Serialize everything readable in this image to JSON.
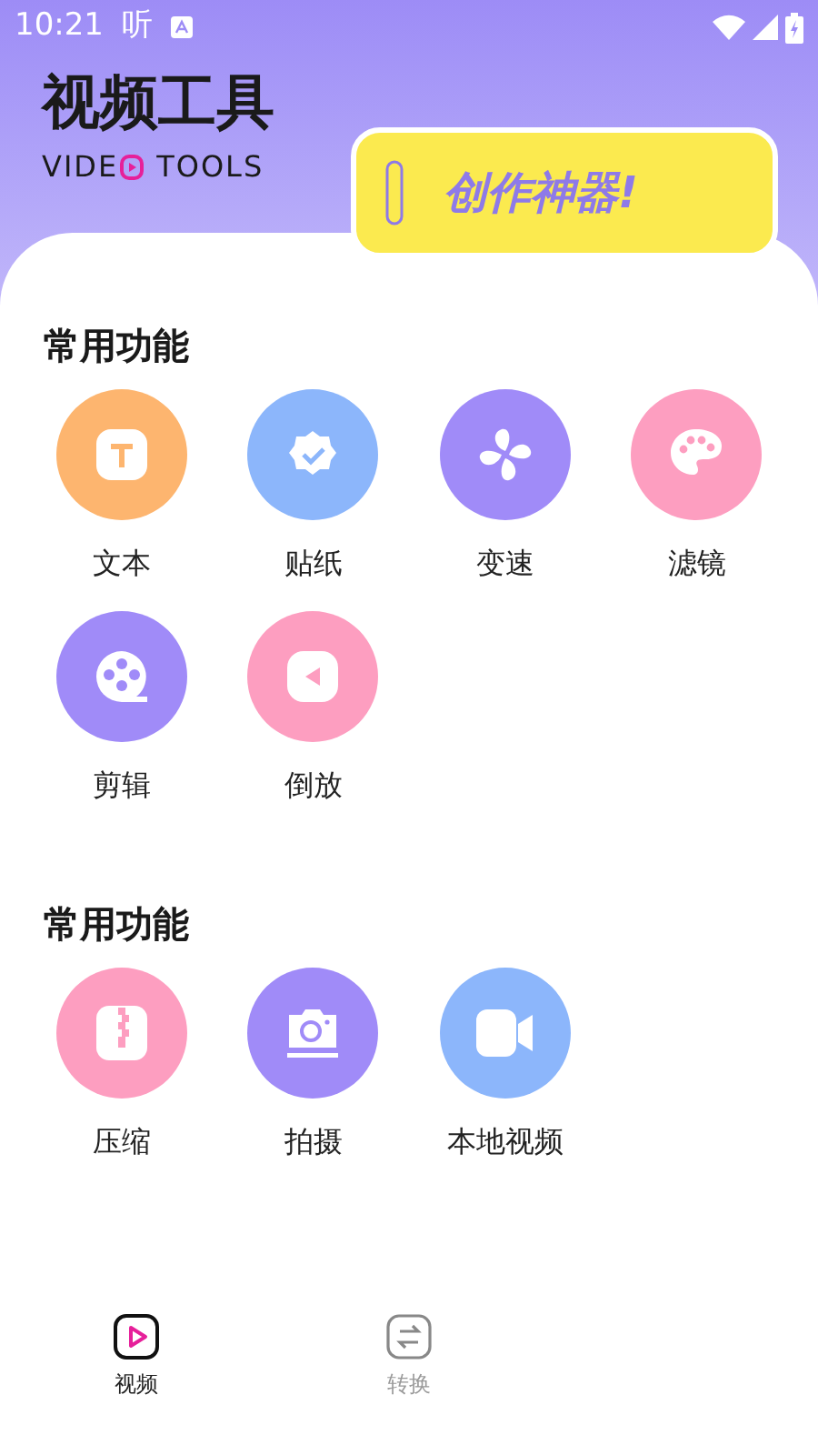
{
  "status_bar": {
    "time": "10:21",
    "listen_glyph": "听"
  },
  "header": {
    "title": "视频工具",
    "subtitle_start": "VIDE",
    "subtitle_end": "TOOLS",
    "badge": "创作神器!"
  },
  "sections": [
    {
      "title": "常用功能",
      "tools": [
        {
          "label": "文本",
          "kind": "text",
          "color": "#fdb56f"
        },
        {
          "label": "贴纸",
          "kind": "sticker",
          "color": "#8cb6fb"
        },
        {
          "label": "变速",
          "kind": "speed",
          "color": "#a08bf8"
        },
        {
          "label": "滤镜",
          "kind": "filter",
          "color": "#fd9ec0"
        },
        {
          "label": "剪辑",
          "kind": "film",
          "color": "#a08bf8"
        },
        {
          "label": "倒放",
          "kind": "reverse",
          "color": "#fd9ec0"
        }
      ]
    },
    {
      "title": "常用功能",
      "tools": [
        {
          "label": "压缩",
          "kind": "zip",
          "color": "#fd9ec0"
        },
        {
          "label": "拍摄",
          "kind": "camera",
          "color": "#a08bf8"
        },
        {
          "label": "本地视频",
          "kind": "video",
          "color": "#8cb6fb"
        }
      ]
    }
  ],
  "nav": [
    {
      "label": "视频",
      "kind": "play",
      "selected": true
    },
    {
      "label": "转换",
      "kind": "swap",
      "selected": false
    }
  ]
}
